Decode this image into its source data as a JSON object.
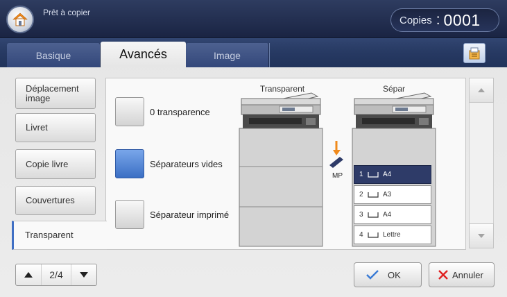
{
  "header": {
    "status": "Prêt à copier",
    "copies_label": "Copies",
    "copies_separator": ":",
    "copies_value": "0001",
    "home_icon": "home-icon"
  },
  "tabs": [
    {
      "label": "Basique",
      "selected": false
    },
    {
      "label": "Avancés",
      "selected": true
    },
    {
      "label": "Image",
      "selected": false
    }
  ],
  "toolbar": {
    "icon": "job-settings-icon"
  },
  "menu": {
    "items": [
      {
        "label": "Déplacement image",
        "selected": false
      },
      {
        "label": "Livret",
        "selected": false
      },
      {
        "label": "Copie livre",
        "selected": false
      },
      {
        "label": "Couvertures",
        "selected": false
      },
      {
        "label": "Transparent",
        "selected": true
      }
    ]
  },
  "options": [
    {
      "label": "0 transparence",
      "selected": false
    },
    {
      "label": "Séparateurs vides",
      "selected": true
    },
    {
      "label": "Séparateur imprimé",
      "selected": false
    }
  ],
  "preview": {
    "left_title": "Transparent",
    "right_title": "Sépar",
    "mp_label": "MP",
    "trays": [
      {
        "number": "1",
        "size": "A4",
        "selected": true
      },
      {
        "number": "2",
        "size": "A3",
        "selected": false
      },
      {
        "number": "3",
        "size": "A4",
        "selected": false
      },
      {
        "number": "4",
        "size": "Lettre",
        "selected": false
      }
    ]
  },
  "scroll": {
    "up_icon": "scroll-up-icon",
    "down_icon": "scroll-down-icon"
  },
  "pager": {
    "text": "2/4",
    "up_icon": "page-up-icon",
    "down_icon": "page-down-icon"
  },
  "actions": {
    "ok_label": "OK",
    "cancel_label": "Annuler",
    "ok_icon": "check-icon",
    "cancel_icon": "close-icon"
  },
  "colors": {
    "header": "#1f2a48",
    "selected_option": "#3b6fc4",
    "tray_selected": "#2e3b68",
    "ok_icon": "#3a7bd5",
    "cancel_icon": "#e02020",
    "mp_arrow": "#f08a1c"
  }
}
